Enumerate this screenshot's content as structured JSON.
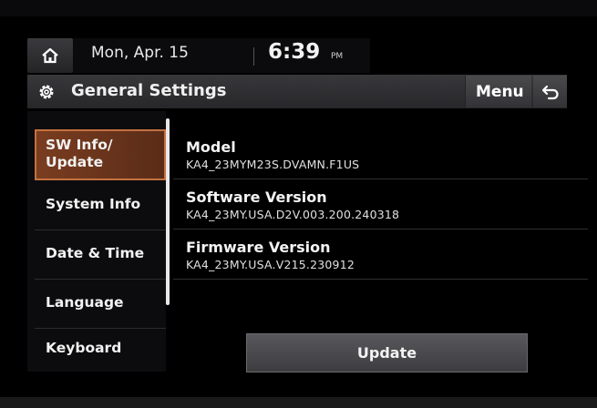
{
  "status_bar": {
    "date": "Mon, Apr. 15",
    "time": "6:39",
    "ampm": "PM"
  },
  "header": {
    "title": "General Settings",
    "menu_label": "Menu"
  },
  "sidebar": {
    "items": [
      {
        "label": "SW Info/",
        "label2": "Update",
        "active": true
      },
      {
        "label": "System Info",
        "active": false
      },
      {
        "label": "Date & Time",
        "active": false
      },
      {
        "label": "Language",
        "active": false
      },
      {
        "label": "Keyboard",
        "active": false
      }
    ]
  },
  "info": {
    "rows": [
      {
        "label": "Model",
        "value": "KA4_23MYM23S.DVAMN.F1US"
      },
      {
        "label": "Software Version",
        "value": "KA4_23MY.USA.D2V.003.200.240318"
      },
      {
        "label": "Firmware Version",
        "value": "KA4_23MY.USA.V215.230912"
      }
    ]
  },
  "update_button": {
    "label": "Update"
  },
  "icons": {
    "home": "home-icon",
    "settings": "gear-icon",
    "back": "back-arrow-icon"
  },
  "colors": {
    "active_item": "#7a3d20",
    "active_border": "#c4713f",
    "background": "#050506"
  }
}
